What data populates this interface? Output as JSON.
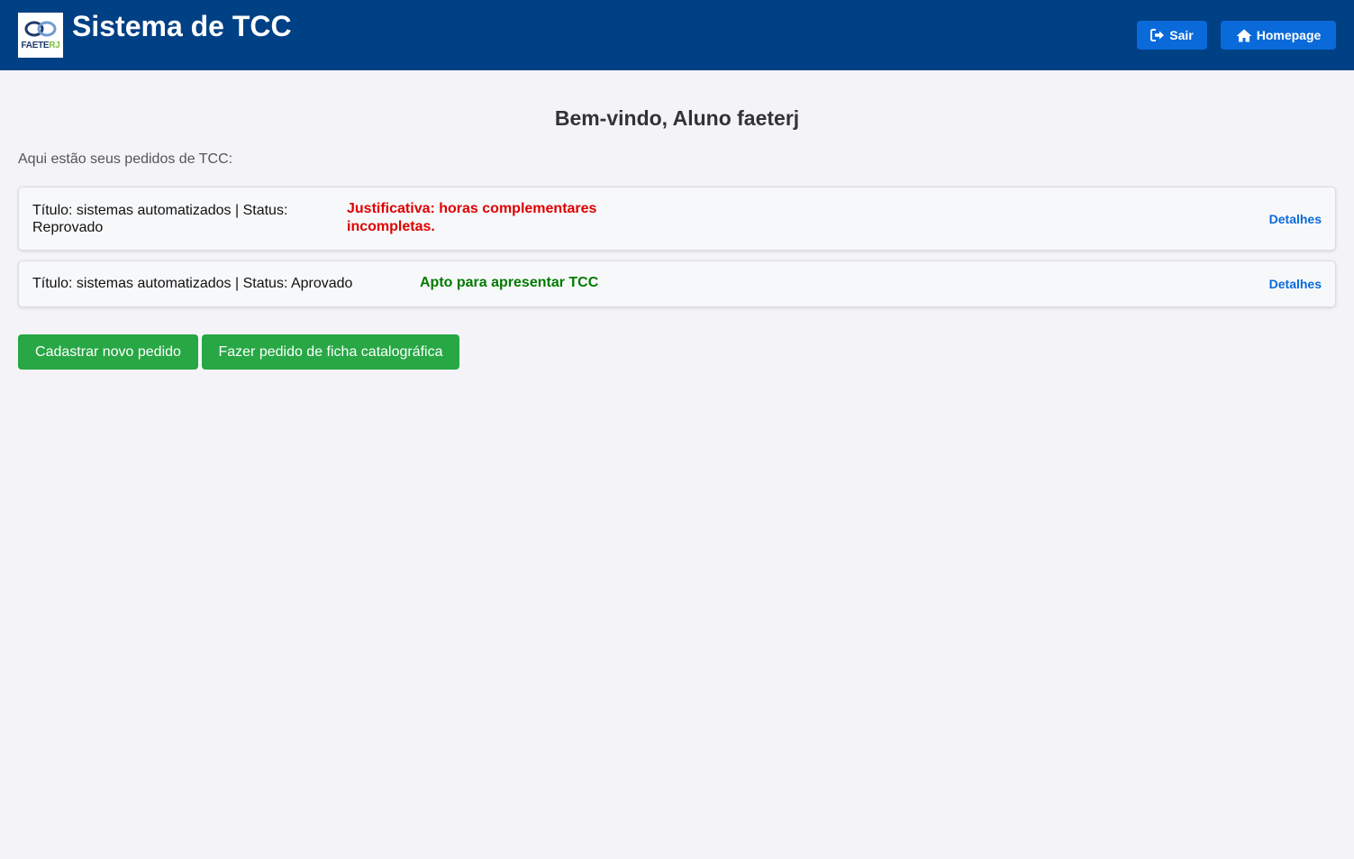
{
  "header": {
    "logo_text_main": "FAETE",
    "logo_text_accent": "RJ",
    "title": "Sistema de TCC",
    "logout_label": "Sair",
    "homepage_label": "Homepage"
  },
  "main": {
    "welcome": "Bem-vindo, Aluno faeterj",
    "subtitle": "Aqui estão seus pedidos de TCC:",
    "requests": [
      {
        "info": "Título: sistemas automatizados | Status: Reprovado",
        "message": "Justificativa: horas complementares incompletas.",
        "message_color": "#e00000",
        "details_label": "Detalhes"
      },
      {
        "info": "Título: sistemas automatizados | Status: Aprovado",
        "message": "Apto para apresentar TCC",
        "message_color": "#007a00",
        "details_label": "Detalhes"
      }
    ],
    "new_request_label": "Cadastrar novo pedido",
    "catalog_request_label": "Fazer pedido de ficha catalográfica"
  },
  "colors": {
    "header_bg": "#004085",
    "primary": "#0a6ad9",
    "success": "#28a745",
    "page_bg": "#f4f4f8"
  },
  "icons": {
    "logout": "sign-out-icon",
    "home": "home-icon"
  }
}
